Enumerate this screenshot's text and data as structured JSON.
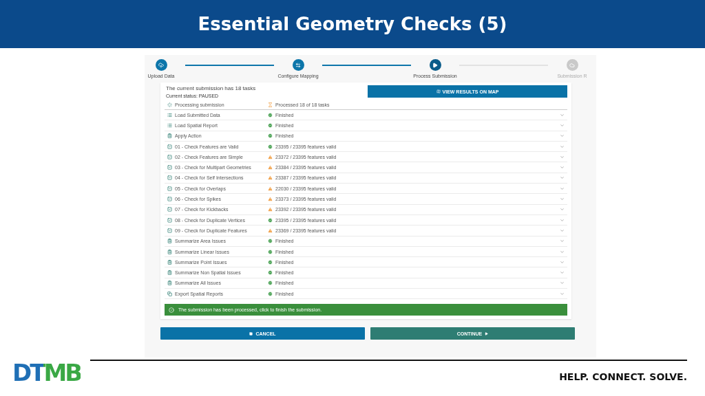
{
  "slide": {
    "title": "Essential Geometry Checks (5)",
    "slogan": "HELP. CONNECT. SOLVE.",
    "logo": "DTMB"
  },
  "stepper": [
    {
      "label": "Upload Data",
      "kind": "upload",
      "completed": true,
      "active": false
    },
    {
      "label": "Configure Mapping",
      "kind": "swap",
      "completed": true,
      "active": false
    },
    {
      "label": "Process Submission",
      "kind": "play",
      "completed": true,
      "active": true
    },
    {
      "label": "Submission R",
      "kind": "cloud",
      "completed": false,
      "active": false
    }
  ],
  "summary": {
    "title": "The current submission has 18 tasks",
    "status": "Current status: PAUSED",
    "map_button": "VIEW RESULTS ON MAP",
    "processing": "Processing submission",
    "processed": "Processed 18 of 18 tasks"
  },
  "tasks": [
    {
      "name": "Load Submitted Data",
      "kind": "list",
      "warning": false,
      "result": "Finished"
    },
    {
      "name": "Load Spatial Report",
      "kind": "list",
      "warning": false,
      "result": "Finished"
    },
    {
      "name": "Apply Action",
      "kind": "clipboard",
      "warning": false,
      "result": "Finished"
    },
    {
      "name": "01 - Check Features are Valid",
      "kind": "check",
      "warning": false,
      "result": "23395 / 23395 features valid"
    },
    {
      "name": "02 - Check Features are Simple",
      "kind": "check",
      "warning": true,
      "result": "23372 / 23395 features valid"
    },
    {
      "name": "03 - Check for Multipart Geometries",
      "kind": "check",
      "warning": true,
      "result": "23384 / 23395 features valid"
    },
    {
      "name": "04 - Check for Self Intersections",
      "kind": "check",
      "warning": true,
      "result": "23387 / 23395 features valid"
    },
    {
      "name": "05 - Check for Overlaps",
      "kind": "check",
      "warning": true,
      "result": "22030 / 23395 features valid"
    },
    {
      "name": "06 - Check for Spikes",
      "kind": "check",
      "warning": true,
      "result": "23373 / 23395 features valid"
    },
    {
      "name": "07 - Check for Kickbacks",
      "kind": "check",
      "warning": true,
      "result": "23392 / 23395 features valid"
    },
    {
      "name": "08 - Check for Duplicate Vertices",
      "kind": "check",
      "warning": false,
      "result": "23395 / 23395 features valid"
    },
    {
      "name": "09 - Check for Duplicate Features",
      "kind": "check",
      "warning": true,
      "result": "23369 / 23395 features valid"
    },
    {
      "name": "Summarize Area Issues",
      "kind": "clipboard",
      "warning": false,
      "result": "Finished"
    },
    {
      "name": "Summarize Linear Issues",
      "kind": "clipboard",
      "warning": false,
      "result": "Finished"
    },
    {
      "name": "Summarize Point Issues",
      "kind": "clipboard",
      "warning": false,
      "result": "Finished"
    },
    {
      "name": "Summarize Non Spatial Issues",
      "kind": "clipboard",
      "warning": false,
      "result": "Finished"
    },
    {
      "name": "Summarize All Issues",
      "kind": "clipboard",
      "warning": false,
      "result": "Finished"
    },
    {
      "name": "Export Spatial Reports",
      "kind": "copy",
      "warning": false,
      "result": "Finished"
    }
  ],
  "banner": "The submission has been processed, click to finish the submission.",
  "buttons": [
    {
      "label": "CANCEL",
      "kind": "cancel"
    },
    {
      "label": "CONTINUE",
      "kind": "continue"
    }
  ]
}
